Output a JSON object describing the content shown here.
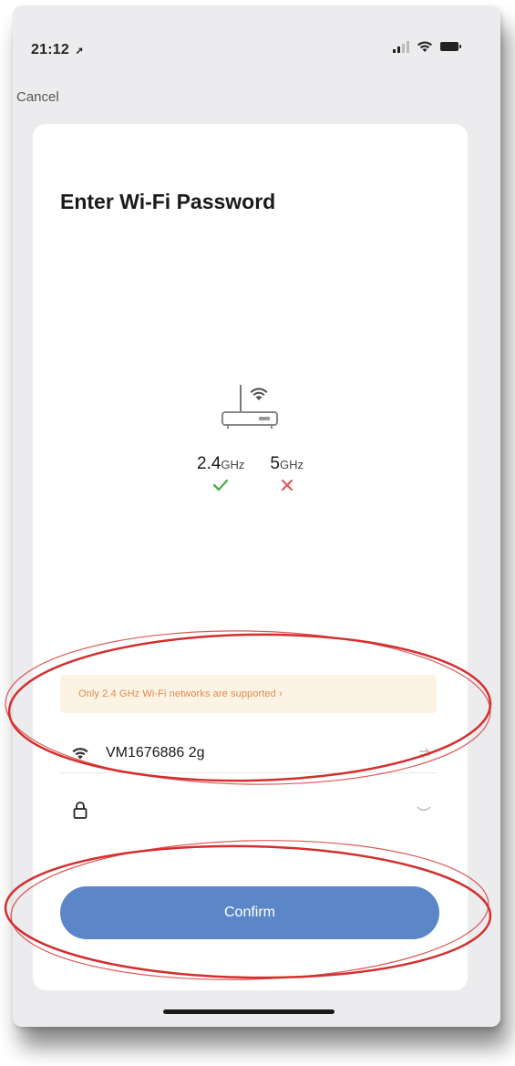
{
  "status_bar": {
    "time": "21:12",
    "location_arrow": "➚"
  },
  "nav": {
    "cancel_label": "Cancel"
  },
  "page": {
    "title": "Enter Wi-Fi Password"
  },
  "bands": [
    {
      "label": "2.4",
      "unit": "GHz",
      "supported": true,
      "status_icon": "check-icon",
      "color": "#4caf50"
    },
    {
      "label": "5",
      "unit": "GHz",
      "supported": false,
      "status_icon": "cross-icon",
      "color": "#e05a5a"
    }
  ],
  "notice": {
    "text": "Only 2.4 GHz Wi-Fi networks are supported ›",
    "text_color": "#e08a4a",
    "background": "#fdf3e5"
  },
  "network": {
    "ssid": "VM1676886 2g",
    "icon": "wifi-icon"
  },
  "password": {
    "value": "",
    "placeholder": "",
    "icon": "lock-icon"
  },
  "confirm": {
    "label": "Confirm",
    "color": "#5b86c8"
  },
  "annotations": {
    "color": "#d32f2f"
  }
}
